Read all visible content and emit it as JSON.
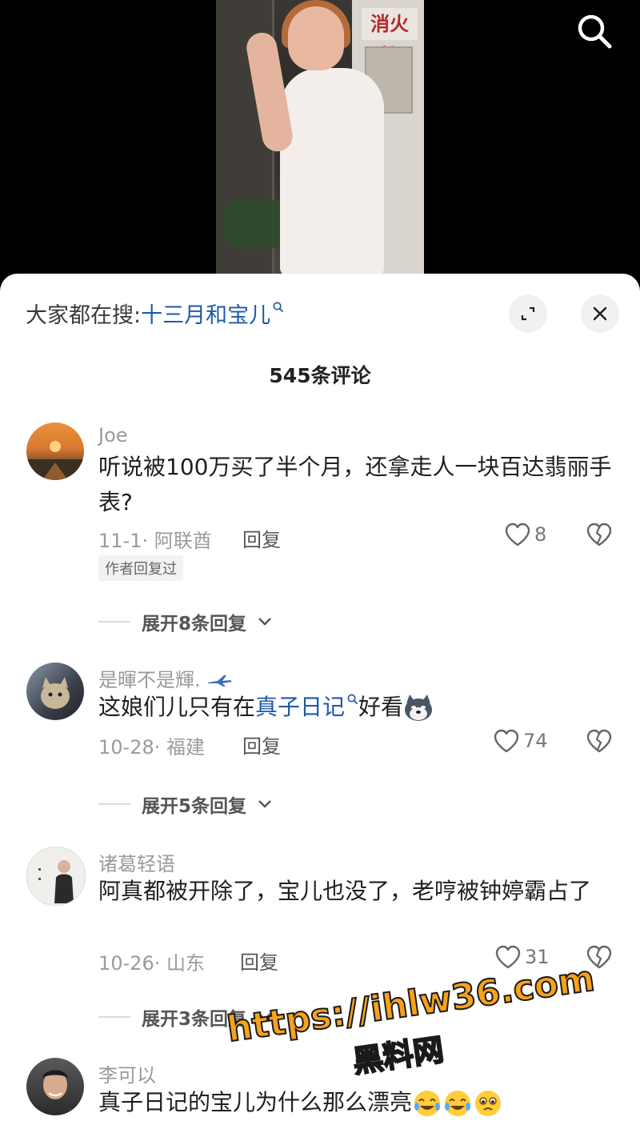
{
  "header": {
    "search_prefix": "大家都在搜:",
    "search_term": "十三月和宝儿",
    "comments_count": "545条评论"
  },
  "icons": {
    "search": "search-icon",
    "expand": "expand-icon",
    "close": "close-icon",
    "like": "heart-icon",
    "dislike": "broken-heart-icon"
  },
  "colors": {
    "link": "#1e5aa8",
    "watermark": "#f7a21b"
  },
  "comments": [
    {
      "username": "Joe",
      "text": "听说被100万买了半个月，还拿走人一块百达翡丽手表?",
      "meta": "11-1· 阿联酋",
      "reply": "回复",
      "likes": "8",
      "badge": "作者回复过",
      "expand": "展开8条回复"
    },
    {
      "username": "是暉不是輝.",
      "text_before": "这娘们儿只有在",
      "text_link": "真子日记",
      "text_after": "好看",
      "meta": "10-28· 福建",
      "reply": "回复",
      "likes": "74",
      "expand": "展开5条回复"
    },
    {
      "username": "诸葛轻语",
      "text": "阿真都被开除了，宝儿也没了，老哼被钟婷霸占了",
      "meta": "10-26· 山东",
      "reply": "回复",
      "likes": "31",
      "expand": "展开3条回复"
    },
    {
      "username": "李可以",
      "text": "真子日记的宝儿为什么那么漂亮"
    }
  ],
  "watermark": {
    "url": "https://ihlw36.com",
    "site": "黑料网"
  },
  "video": {
    "sign_text": "消火栓"
  }
}
